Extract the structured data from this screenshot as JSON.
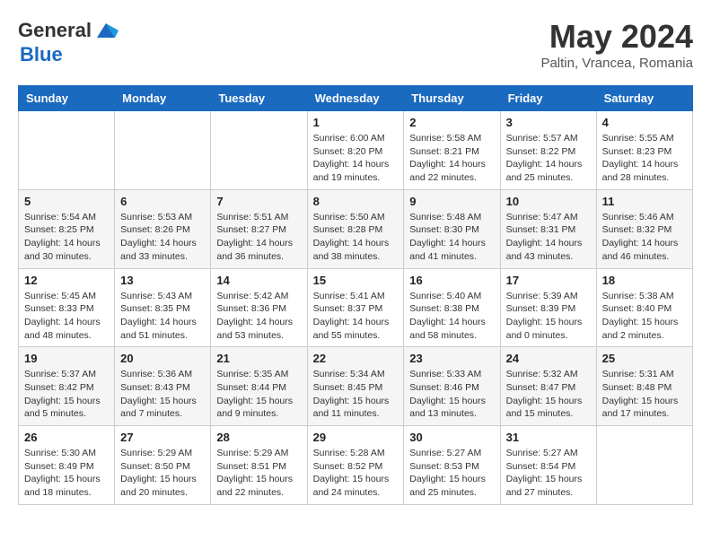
{
  "logo": {
    "general": "General",
    "blue": "Blue"
  },
  "header": {
    "month_title": "May 2024",
    "subtitle": "Paltin, Vrancea, Romania"
  },
  "days_of_week": [
    "Sunday",
    "Monday",
    "Tuesday",
    "Wednesday",
    "Thursday",
    "Friday",
    "Saturday"
  ],
  "weeks": [
    [
      {
        "day": "",
        "info": ""
      },
      {
        "day": "",
        "info": ""
      },
      {
        "day": "",
        "info": ""
      },
      {
        "day": "1",
        "info": "Sunrise: 6:00 AM\nSunset: 8:20 PM\nDaylight: 14 hours\nand 19 minutes."
      },
      {
        "day": "2",
        "info": "Sunrise: 5:58 AM\nSunset: 8:21 PM\nDaylight: 14 hours\nand 22 minutes."
      },
      {
        "day": "3",
        "info": "Sunrise: 5:57 AM\nSunset: 8:22 PM\nDaylight: 14 hours\nand 25 minutes."
      },
      {
        "day": "4",
        "info": "Sunrise: 5:55 AM\nSunset: 8:23 PM\nDaylight: 14 hours\nand 28 minutes."
      }
    ],
    [
      {
        "day": "5",
        "info": "Sunrise: 5:54 AM\nSunset: 8:25 PM\nDaylight: 14 hours\nand 30 minutes."
      },
      {
        "day": "6",
        "info": "Sunrise: 5:53 AM\nSunset: 8:26 PM\nDaylight: 14 hours\nand 33 minutes."
      },
      {
        "day": "7",
        "info": "Sunrise: 5:51 AM\nSunset: 8:27 PM\nDaylight: 14 hours\nand 36 minutes."
      },
      {
        "day": "8",
        "info": "Sunrise: 5:50 AM\nSunset: 8:28 PM\nDaylight: 14 hours\nand 38 minutes."
      },
      {
        "day": "9",
        "info": "Sunrise: 5:48 AM\nSunset: 8:30 PM\nDaylight: 14 hours\nand 41 minutes."
      },
      {
        "day": "10",
        "info": "Sunrise: 5:47 AM\nSunset: 8:31 PM\nDaylight: 14 hours\nand 43 minutes."
      },
      {
        "day": "11",
        "info": "Sunrise: 5:46 AM\nSunset: 8:32 PM\nDaylight: 14 hours\nand 46 minutes."
      }
    ],
    [
      {
        "day": "12",
        "info": "Sunrise: 5:45 AM\nSunset: 8:33 PM\nDaylight: 14 hours\nand 48 minutes."
      },
      {
        "day": "13",
        "info": "Sunrise: 5:43 AM\nSunset: 8:35 PM\nDaylight: 14 hours\nand 51 minutes."
      },
      {
        "day": "14",
        "info": "Sunrise: 5:42 AM\nSunset: 8:36 PM\nDaylight: 14 hours\nand 53 minutes."
      },
      {
        "day": "15",
        "info": "Sunrise: 5:41 AM\nSunset: 8:37 PM\nDaylight: 14 hours\nand 55 minutes."
      },
      {
        "day": "16",
        "info": "Sunrise: 5:40 AM\nSunset: 8:38 PM\nDaylight: 14 hours\nand 58 minutes."
      },
      {
        "day": "17",
        "info": "Sunrise: 5:39 AM\nSunset: 8:39 PM\nDaylight: 15 hours\nand 0 minutes."
      },
      {
        "day": "18",
        "info": "Sunrise: 5:38 AM\nSunset: 8:40 PM\nDaylight: 15 hours\nand 2 minutes."
      }
    ],
    [
      {
        "day": "19",
        "info": "Sunrise: 5:37 AM\nSunset: 8:42 PM\nDaylight: 15 hours\nand 5 minutes."
      },
      {
        "day": "20",
        "info": "Sunrise: 5:36 AM\nSunset: 8:43 PM\nDaylight: 15 hours\nand 7 minutes."
      },
      {
        "day": "21",
        "info": "Sunrise: 5:35 AM\nSunset: 8:44 PM\nDaylight: 15 hours\nand 9 minutes."
      },
      {
        "day": "22",
        "info": "Sunrise: 5:34 AM\nSunset: 8:45 PM\nDaylight: 15 hours\nand 11 minutes."
      },
      {
        "day": "23",
        "info": "Sunrise: 5:33 AM\nSunset: 8:46 PM\nDaylight: 15 hours\nand 13 minutes."
      },
      {
        "day": "24",
        "info": "Sunrise: 5:32 AM\nSunset: 8:47 PM\nDaylight: 15 hours\nand 15 minutes."
      },
      {
        "day": "25",
        "info": "Sunrise: 5:31 AM\nSunset: 8:48 PM\nDaylight: 15 hours\nand 17 minutes."
      }
    ],
    [
      {
        "day": "26",
        "info": "Sunrise: 5:30 AM\nSunset: 8:49 PM\nDaylight: 15 hours\nand 18 minutes."
      },
      {
        "day": "27",
        "info": "Sunrise: 5:29 AM\nSunset: 8:50 PM\nDaylight: 15 hours\nand 20 minutes."
      },
      {
        "day": "28",
        "info": "Sunrise: 5:29 AM\nSunset: 8:51 PM\nDaylight: 15 hours\nand 22 minutes."
      },
      {
        "day": "29",
        "info": "Sunrise: 5:28 AM\nSunset: 8:52 PM\nDaylight: 15 hours\nand 24 minutes."
      },
      {
        "day": "30",
        "info": "Sunrise: 5:27 AM\nSunset: 8:53 PM\nDaylight: 15 hours\nand 25 minutes."
      },
      {
        "day": "31",
        "info": "Sunrise: 5:27 AM\nSunset: 8:54 PM\nDaylight: 15 hours\nand 27 minutes."
      },
      {
        "day": "",
        "info": ""
      }
    ]
  ]
}
